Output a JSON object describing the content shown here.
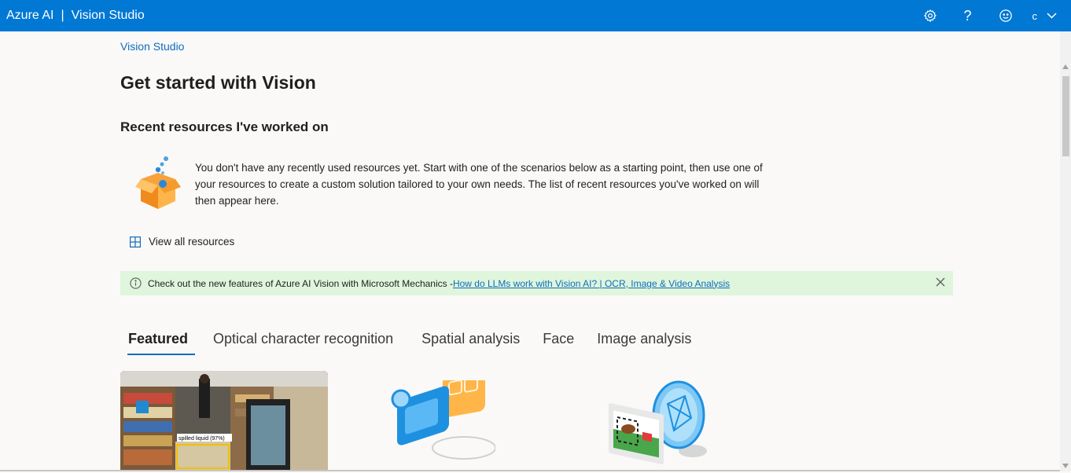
{
  "header": {
    "brand": "Azure AI",
    "separator": "|",
    "product": "Vision Studio",
    "account_initial": "c",
    "icons": [
      "gear-icon",
      "help-icon",
      "feedback-smiley-icon",
      "chevron-down-icon"
    ]
  },
  "breadcrumb": "Vision Studio",
  "page_title": "Get started with Vision",
  "recent": {
    "heading": "Recent resources I've worked on",
    "empty_message": "You don't have any recently used resources yet. Start with one of the scenarios below as a starting point, then use one of your resources to create a custom solution tailored to your own needs. The list of recent resources you've worked on will then appear here.",
    "view_all": "View all resources"
  },
  "banner": {
    "text": "Check out the new features of Azure AI Vision with Microsoft Mechanics - ",
    "link": "How do LLMs work with Vision AI? | OCR, Image & Video Analysis"
  },
  "tabs": [
    {
      "label": "Featured",
      "active": true
    },
    {
      "label": "Optical character recognition",
      "active": false
    },
    {
      "label": "Spatial analysis",
      "active": false
    },
    {
      "label": "Face",
      "active": false
    },
    {
      "label": "Image analysis",
      "active": false
    }
  ],
  "cards": {
    "photo_tag": "spilled liquid (97%)"
  },
  "colors": {
    "header": "#0078d4",
    "link": "#0f6cbd",
    "banner_bg": "#dff6dd"
  }
}
